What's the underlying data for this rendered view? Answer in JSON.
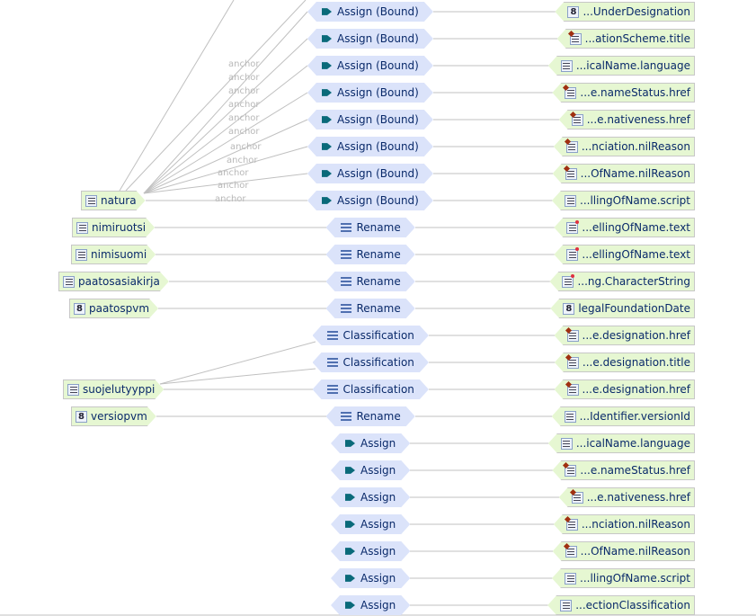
{
  "sources": [
    {
      "row": 7,
      "label": "natura",
      "icon": "list-icon"
    },
    {
      "row": 8,
      "label": "nimiruotsi",
      "icon": "list-icon"
    },
    {
      "row": 9,
      "label": "nimisuomi",
      "icon": "list-icon"
    },
    {
      "row": 10,
      "label": "paatosasiakirja",
      "icon": "list-icon"
    },
    {
      "row": 11,
      "label": "paatospvm",
      "icon": "number-icon"
    },
    {
      "row": 14,
      "label": "suojelutyyppi",
      "icon": "list-icon"
    },
    {
      "row": 15,
      "label": "versiopvm",
      "icon": "number-icon"
    }
  ],
  "functions": [
    {
      "label": "Assign (Bound)",
      "icon": "assign-icon"
    },
    {
      "label": "Assign (Bound)",
      "icon": "assign-icon"
    },
    {
      "label": "Assign (Bound)",
      "icon": "assign-icon"
    },
    {
      "label": "Assign (Bound)",
      "icon": "assign-icon"
    },
    {
      "label": "Assign (Bound)",
      "icon": "assign-icon"
    },
    {
      "label": "Assign (Bound)",
      "icon": "assign-icon"
    },
    {
      "label": "Assign (Bound)",
      "icon": "assign-icon"
    },
    {
      "label": "Assign (Bound)",
      "icon": "assign-icon"
    },
    {
      "label": "Rename",
      "icon": "rename-icon"
    },
    {
      "label": "Rename",
      "icon": "rename-icon"
    },
    {
      "label": "Rename",
      "icon": "rename-icon"
    },
    {
      "label": "Rename",
      "icon": "rename-icon"
    },
    {
      "label": "Classification",
      "icon": "classification-icon"
    },
    {
      "label": "Classification",
      "icon": "classification-icon"
    },
    {
      "label": "Classification",
      "icon": "classification-icon"
    },
    {
      "label": "Rename",
      "icon": "rename-icon"
    },
    {
      "label": "Assign",
      "icon": "assign-icon"
    },
    {
      "label": "Assign",
      "icon": "assign-icon"
    },
    {
      "label": "Assign",
      "icon": "assign-icon"
    },
    {
      "label": "Assign",
      "icon": "assign-icon"
    },
    {
      "label": "Assign",
      "icon": "assign-icon"
    },
    {
      "label": "Assign",
      "icon": "assign-icon"
    },
    {
      "label": "Assign",
      "icon": "assign-icon"
    }
  ],
  "targets": [
    {
      "label": "...UnderDesignation",
      "icon": "number-icon"
    },
    {
      "label": "...ationScheme.title",
      "icon": "reference-list-icon"
    },
    {
      "label": "...icalName.language",
      "icon": "list-icon"
    },
    {
      "label": "...e.nameStatus.href",
      "icon": "reference-list-icon"
    },
    {
      "label": "...e.nativeness.href",
      "icon": "reference-list-icon"
    },
    {
      "label": "...nciation.nilReason",
      "icon": "reference-list-icon"
    },
    {
      "label": "...OfName.nilReason",
      "icon": "reference-list-icon"
    },
    {
      "label": "...llingOfName.script",
      "icon": "list-icon"
    },
    {
      "label": "...ellingOfName.text",
      "icon": "required-list-icon"
    },
    {
      "label": "...ellingOfName.text",
      "icon": "required-list-icon"
    },
    {
      "label": "...ng.CharacterString",
      "icon": "required-list-icon"
    },
    {
      "label": "legalFoundationDate",
      "icon": "number-icon"
    },
    {
      "label": "...e.designation.href",
      "icon": "reference-list-icon"
    },
    {
      "label": "...e.designation.title",
      "icon": "reference-list-icon"
    },
    {
      "label": "...e.designation.href",
      "icon": "reference-list-icon"
    },
    {
      "label": "...Identifier.versionId",
      "icon": "list-icon"
    },
    {
      "label": "...icalName.language",
      "icon": "list-icon"
    },
    {
      "label": "...e.nameStatus.href",
      "icon": "reference-list-icon"
    },
    {
      "label": "...e.nativeness.href",
      "icon": "reference-list-icon"
    },
    {
      "label": "...nciation.nilReason",
      "icon": "reference-list-icon"
    },
    {
      "label": "...OfName.nilReason",
      "icon": "reference-list-icon"
    },
    {
      "label": "...llingOfName.script",
      "icon": "list-icon"
    },
    {
      "label": "...ectionClassification",
      "icon": "list-icon"
    }
  ],
  "anchor_labels": [
    "anchor",
    "anchor",
    "anchor",
    "anchor",
    "anchor",
    "anchor",
    "anchor",
    "anchor",
    "anchor",
    "anchor",
    "anchor"
  ],
  "colors": {
    "source_fill": "#e6f7d2",
    "function_fill": "#dbe3fa",
    "connector": "#c0c0c0",
    "text": "#0a2a6a"
  }
}
